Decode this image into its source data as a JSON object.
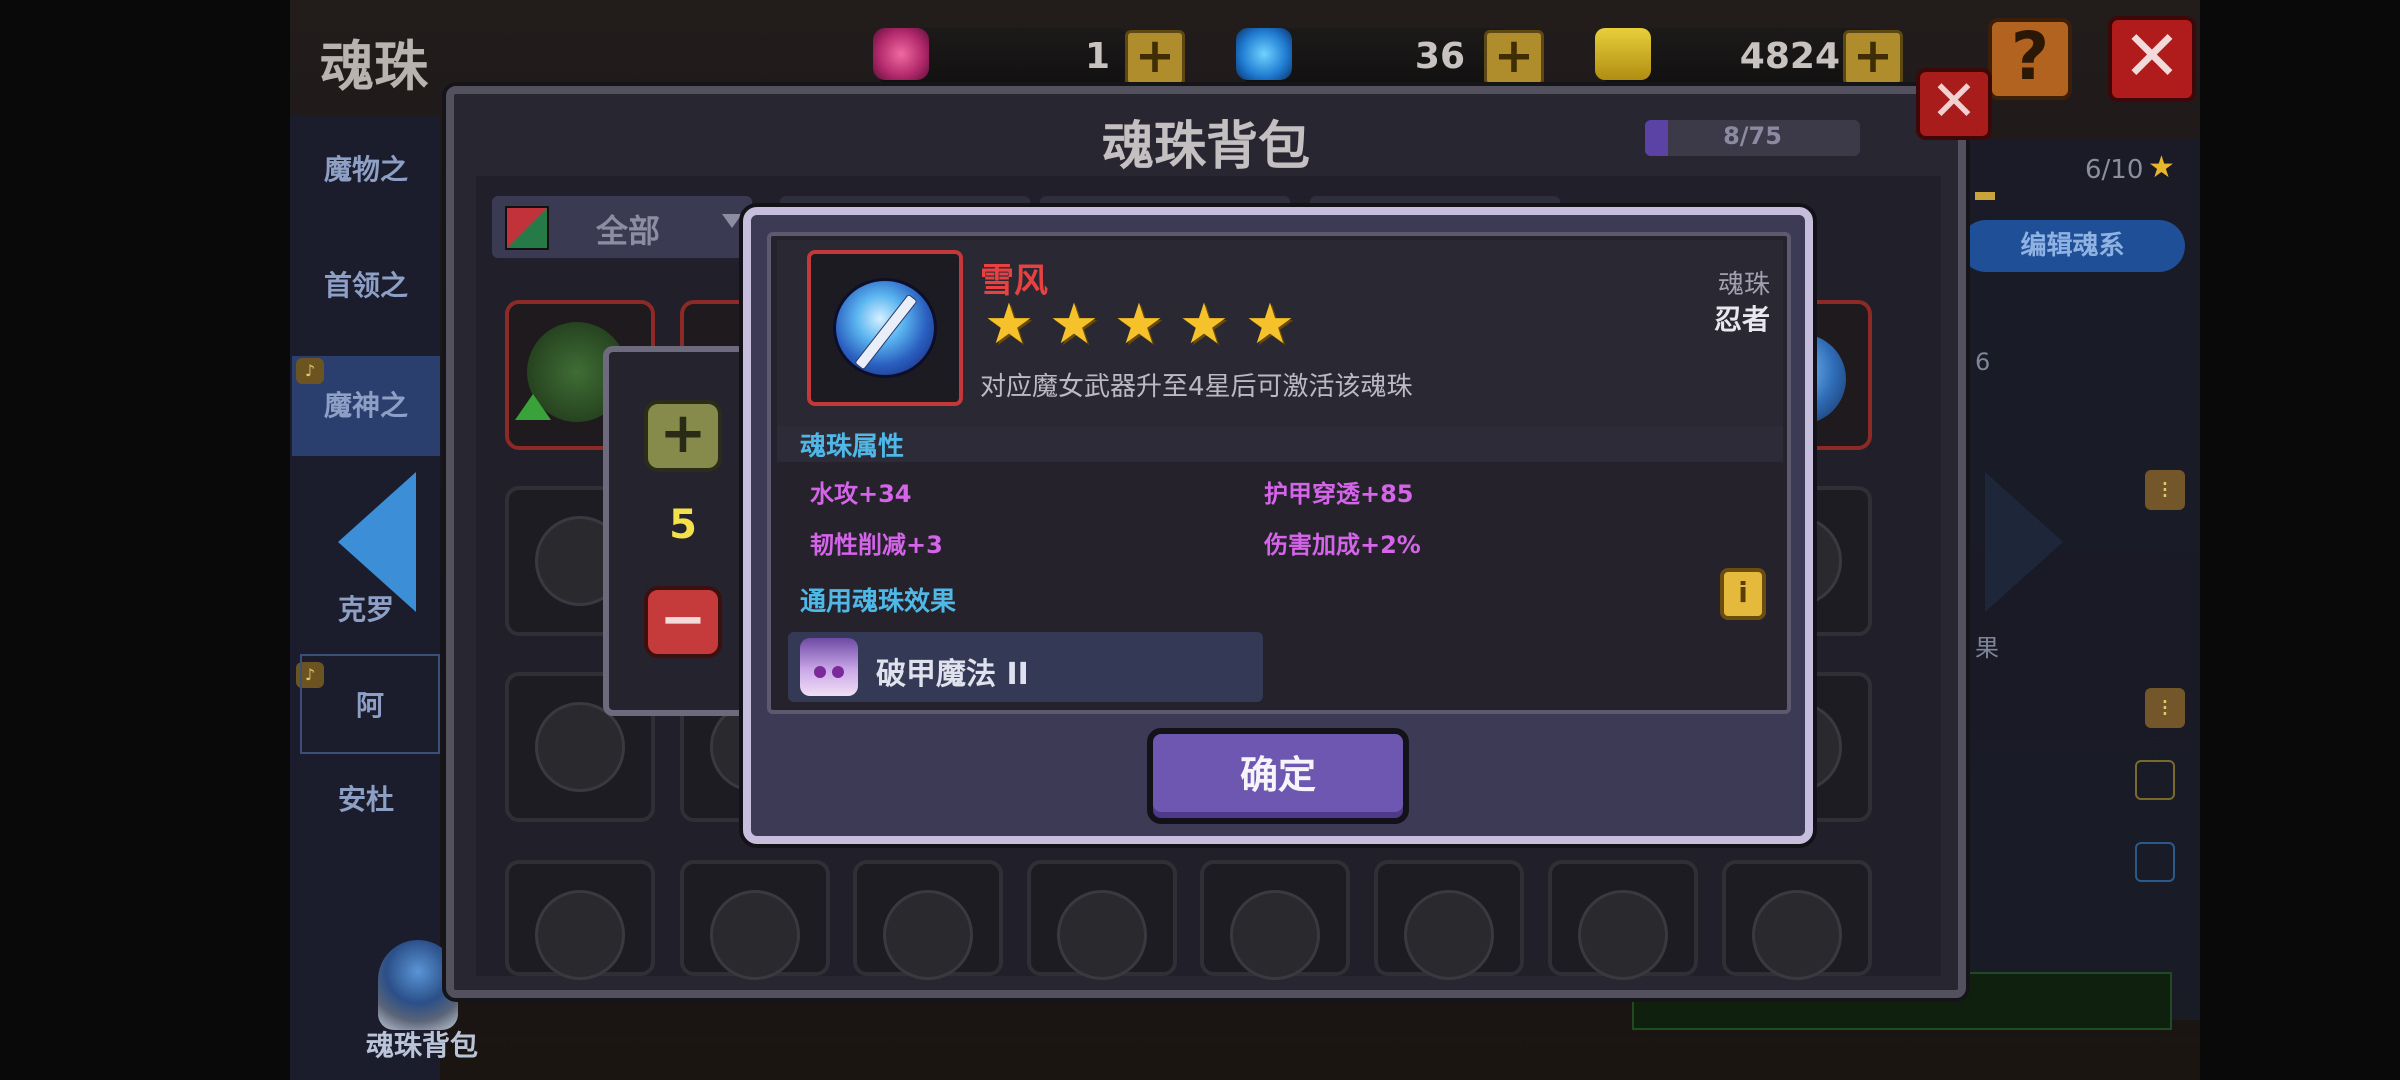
{
  "screen": {
    "title": "魂珠"
  },
  "currency": [
    {
      "name": "gem",
      "icon": "pink-gem-icon",
      "value": "1"
    },
    {
      "name": "crystal",
      "icon": "blue-crystal-icon",
      "value": "36"
    },
    {
      "name": "coin",
      "icon": "gold-coin-icon",
      "value": "4824"
    }
  ],
  "top_buttons": {
    "help": "?",
    "close": "✕"
  },
  "left_menu": {
    "items": [
      {
        "label": "魔物之"
      },
      {
        "label": "首领之"
      },
      {
        "label": "魔神之"
      },
      {
        "label": "克罗"
      },
      {
        "label": "阿"
      },
      {
        "label": "安杜"
      }
    ],
    "backpack_label": "魂珠背包"
  },
  "right_panel": {
    "progress": "6/10",
    "edit_series_label": "编辑魂系",
    "fragment_a": "6",
    "fragment_b": "果"
  },
  "backpack_window": {
    "title": "魂珠背包",
    "capacity": "8/75",
    "capacity_fraction": 0.107,
    "close": "✕",
    "filter_label": "全部"
  },
  "quantity_panel": {
    "plus": "+",
    "value": "5",
    "minus": "−"
  },
  "detail": {
    "name": "雪风",
    "stars": 5,
    "star_glyph": "★",
    "description": "对应魔女武器升至4星后可激活该魂珠",
    "type_label": "魂珠",
    "class_label": "忍者",
    "attributes_header": "魂珠属性",
    "attributes": [
      {
        "text": "水攻+34"
      },
      {
        "text": "护甲穿透+85"
      },
      {
        "text": "韧性削减+3"
      },
      {
        "text": "伤害加成+2%"
      }
    ],
    "effect_header": "通用魂珠效果",
    "effect_info_glyph": "i",
    "effect_name": "破甲魔法 II",
    "confirm_label": "确定"
  },
  "colors": {
    "bead_name": "#e84141",
    "section_header": "#4fb8e6",
    "attribute": "#d464e8",
    "star": "#f6c22c",
    "confirm": "#6e57b0"
  }
}
